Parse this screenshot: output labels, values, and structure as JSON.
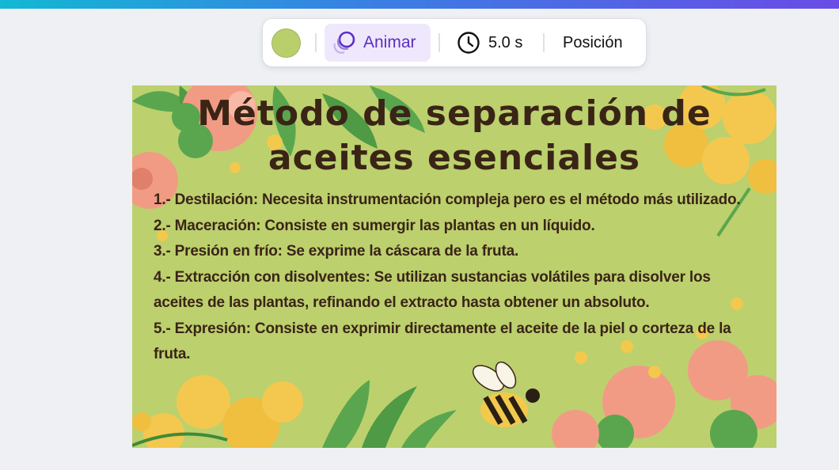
{
  "toolbar": {
    "swatch_color": "#b8cf6b",
    "animate_label": "Animar",
    "duration_label": "5.0 s",
    "position_label": "Posición",
    "accent_color": "#5b2fc2"
  },
  "slide": {
    "background": "#bcd06e",
    "title_line1": "Método de separación de",
    "title_line2": "aceites esenciales",
    "lines": [
      "1.- Destilación: Necesita instrumentación compleja pero es el método más utilizado.",
      "2.- Maceración: Consiste en sumergir las plantas en un líquido.",
      "3.- Presión en frío: Se exprime la cáscara de la fruta.",
      "4.- Extracción con disolventes: Se utilizan sustancias volátiles para disolver los",
      "aceites de las plantas, refinando el extracto hasta obtener un absoluto.",
      "5.- Expresión: Consiste en exprimir directamente el aceite de la piel o corteza de la",
      "fruta."
    ]
  }
}
